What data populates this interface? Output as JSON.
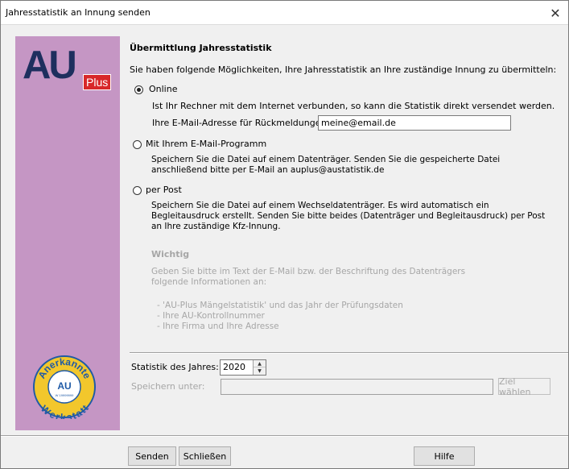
{
  "window": {
    "title": "Jahresstatistik an Innung senden",
    "close_glyph": "✕"
  },
  "logo": {
    "main": "AU",
    "badge": "Plus"
  },
  "seal": {
    "top_text": "Anerkannte",
    "bottom_text": "Werkstatt",
    "center": "AU",
    "number": "W 19999999"
  },
  "header": {
    "heading": "Übermittlung Jahresstatistik",
    "intro": "Sie haben folgende Möglichkeiten, Ihre Jahresstatistik an Ihre zuständige Innung zu übermitteln:"
  },
  "options": {
    "online": {
      "label": "Online",
      "selected": true,
      "description": "Ist Ihr Rechner mit dem Internet verbunden, so kann die Statistik direkt versendet werden.",
      "email_label": "Ihre E-Mail-Adresse für Rückmeldungen:",
      "email_value": "meine@email.de"
    },
    "email": {
      "label": "Mit Ihrem E-Mail-Programm",
      "selected": false,
      "description": "Speichern Sie die Datei auf einem Datenträger. Senden Sie die  gespeicherte Datei anschließend bitte per E-Mail an auplus@austatistik.de"
    },
    "post": {
      "label": "per Post",
      "selected": false,
      "description": "Speichern Sie die Datei auf einem Wechseldatenträger. Es wird automatisch ein Begleitausdruck erstellt. Senden Sie bitte beides (Datenträger und Begleitausdruck) per Post an Ihre zuständige Kfz-Innung."
    }
  },
  "important": {
    "title": "Wichtig",
    "text": "Geben Sie bitte im Text der E-Mail bzw. der Beschriftung des Datenträgers folgende Informationen an:",
    "items": [
      "- 'AU-Plus Mängelstatistik' und das Jahr der Prüfungsdaten",
      "- Ihre AU-Kontrollnummer",
      "- Ihre Firma und Ihre Adresse"
    ]
  },
  "stats": {
    "year_label": "Statistik des Jahres:",
    "year_value": "2020",
    "save_label": "Speichern unter:",
    "save_value": "",
    "choose_button": "Ziel wählen"
  },
  "buttons": {
    "send": "Senden",
    "close": "Schließen",
    "help": "Hilfe"
  },
  "colors": {
    "sidebar": "#c596c4",
    "logo_blue": "#1e2f5e",
    "logo_red": "#d8282a",
    "seal_yellow": "#f2c72c",
    "seal_blue": "#1f5aa6"
  }
}
